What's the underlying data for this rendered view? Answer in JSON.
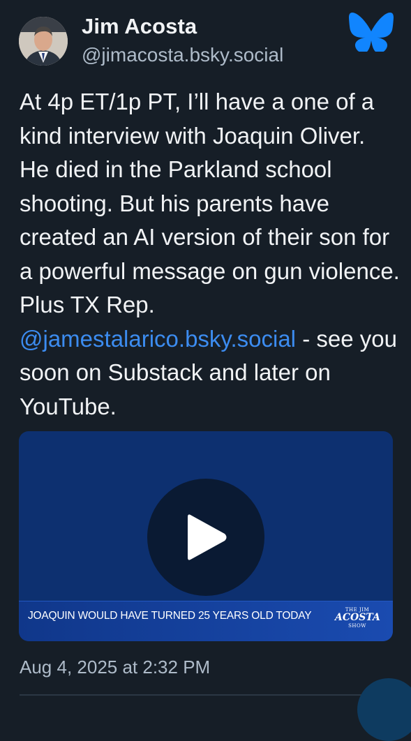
{
  "author": {
    "display_name": "Jim Acosta",
    "handle": "@jimacosta.bsky.social",
    "avatar_icon": "profile-photo"
  },
  "brand_icon": "bluesky-butterfly-icon",
  "colors": {
    "background": "#161e27",
    "text": "#f1f3f5",
    "muted": "#aebbc9",
    "link": "#3c8cf0",
    "brand": "#1185fe"
  },
  "post": {
    "text_before": "At 4p ET/1p PT, I’ll have a one of a kind interview with Joaquin Oliver. He died in the Parkland school shooting. But his parents have created an AI version of their son for a powerful message on gun violence. Plus TX Rep. ",
    "mention": "@jamestalarico.bsky.social",
    "text_after": " - see you soon on Substack and later on YouTube."
  },
  "video": {
    "play_icon": "play-icon",
    "caption": "JOAQUIN WOULD HAVE TURNED 25 YEARS OLD TODAY",
    "show_logo": {
      "line1": "THE JIM",
      "line2": "ACOSTA",
      "line3": "SHOW"
    }
  },
  "timestamp": "Aug 4, 2025 at 2:32 PM"
}
